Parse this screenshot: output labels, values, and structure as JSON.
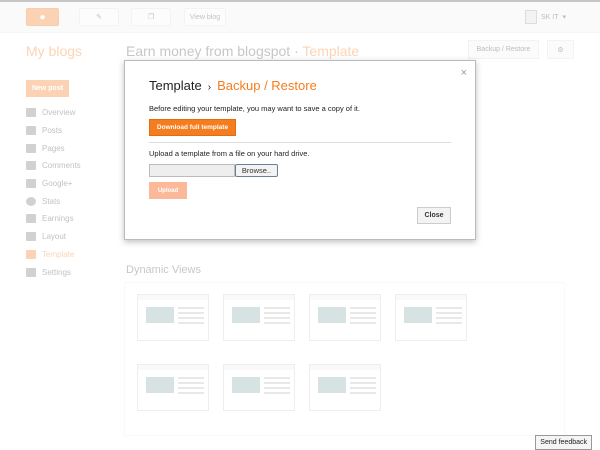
{
  "topbar": {
    "view_blog": "View blog",
    "user": "SK IT"
  },
  "header": {
    "my_blogs": "My blogs",
    "blog_name": "Earn money from blogspot",
    "separator": "·",
    "section": "Template",
    "backup_restore": "Backup / Restore"
  },
  "sidebar": {
    "new_post": "New post",
    "items": [
      {
        "label": "Overview"
      },
      {
        "label": "Posts"
      },
      {
        "label": "Pages"
      },
      {
        "label": "Comments"
      },
      {
        "label": "Google+"
      },
      {
        "label": "Stats"
      },
      {
        "label": "Earnings"
      },
      {
        "label": "Layout"
      },
      {
        "label": "Template"
      },
      {
        "label": "Settings"
      }
    ]
  },
  "main": {
    "dynamic_views": "Dynamic Views"
  },
  "modal": {
    "title": "Template",
    "separator": "›",
    "subtitle": "Backup / Restore",
    "close_x": "×",
    "save_text": "Before editing your template, you may want to save a copy of it.",
    "download": "Download full template",
    "upload_text": "Upload a template from a file on your hard drive.",
    "browse": "Browse..",
    "upload": "Upload",
    "close": "Close"
  },
  "feedback": "Send feedback",
  "colors": {
    "accent": "#f57d1f"
  }
}
